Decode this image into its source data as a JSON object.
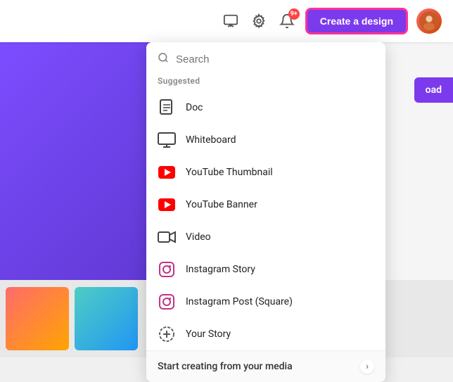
{
  "header": {
    "create_button_label": "Create a design",
    "notification_badge": "9+"
  },
  "dropdown": {
    "search_placeholder": "Search",
    "suggested_label": "Suggested",
    "items": [
      {
        "id": "doc",
        "label": "Doc",
        "icon": "doc"
      },
      {
        "id": "whiteboard",
        "label": "Whiteboard",
        "icon": "whiteboard"
      },
      {
        "id": "youtube-thumbnail",
        "label": "YouTube Thumbnail",
        "icon": "youtube"
      },
      {
        "id": "youtube-banner",
        "label": "YouTube Banner",
        "icon": "youtube"
      },
      {
        "id": "video",
        "label": "Video",
        "icon": "video"
      },
      {
        "id": "instagram-story",
        "label": "Instagram Story",
        "icon": "instagram"
      },
      {
        "id": "instagram-post",
        "label": "Instagram Post (Square)",
        "icon": "instagram"
      },
      {
        "id": "your-story",
        "label": "Your Story",
        "icon": "your-story"
      }
    ],
    "start_creating_label": "Start creating from your media"
  },
  "sidebar": {
    "load_label": "oad"
  }
}
